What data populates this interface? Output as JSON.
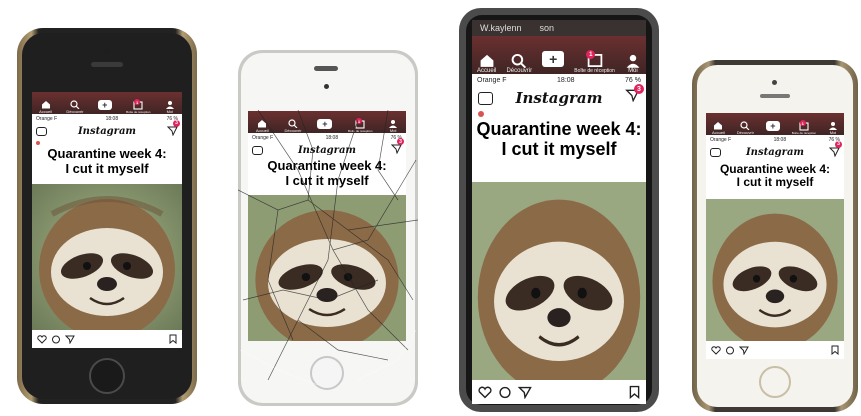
{
  "nav": {
    "home": "Accueil",
    "search": "Découvrir",
    "plus": "+",
    "inbox": "Boîte de réception",
    "me": "Moi",
    "notif_count": "1"
  },
  "status": {
    "carrier": "Orange F",
    "time": "18:08",
    "battery": "76 %"
  },
  "instagram": {
    "logo": "Instagram",
    "dm_badge": "3",
    "caption_line1": "Quarantine week 4:",
    "caption_line2": "I cut it myself"
  },
  "phone3_top": {
    "left": "W.kaylenn",
    "right": "son"
  },
  "icons": [
    "home-icon",
    "search-icon",
    "plus-icon",
    "inbox-icon",
    "profile-icon",
    "camera-icon",
    "direct-message-icon",
    "heart-icon",
    "comment-icon",
    "share-icon",
    "bookmark-icon"
  ],
  "colors": {
    "nav_dark": "#4a2a2a",
    "badge_red": "#e0245e",
    "gold_frame": "#9a8a66",
    "dark_frame": "#2a2a2a",
    "white_frame": "#f4f4f2",
    "case_gray": "#4a4a4a"
  }
}
